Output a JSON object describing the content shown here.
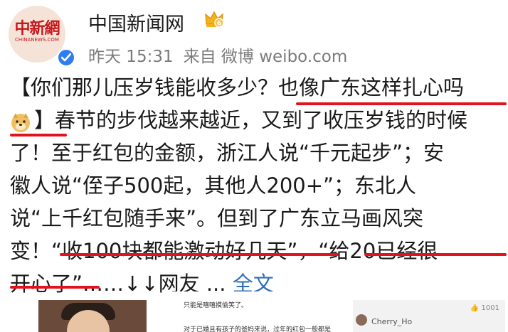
{
  "account": {
    "name": "中国新闻网",
    "avatar_logo": "中新網",
    "avatar_sub": "CHINANEWS.COM",
    "verified_icon": "verified-check-icon",
    "vip_icon": "crown-badge-icon",
    "time": "昨天 15:31",
    "source": "来自 微博 weibo.com"
  },
  "post": {
    "line1": "【你们那儿压岁钱能收多少？也像广东这样扎心吗",
    "line2": "】春节的步伐越来越近，又到了收压岁钱的时候",
    "line3": "了！至于红包的金额，浙江人说“千元起步”；安",
    "line4": "徽人说“侄子500起，其他人200+”；东北人",
    "line5": "说“上千红包随手来”。但到了广东立马画风突",
    "line6": "变！“收100块都能激动好几天”，“给20已经很",
    "line7_text": "开心了”……↓↓网友 ... ",
    "line7_link": "全文",
    "emoji": "doge-emoji",
    "highlight_color": "#e0141e",
    "link_color": "#2f6fb9"
  },
  "previews": {
    "article_line1": "只能是嘻嘻摸偷笑了。",
    "article_line2": "对于已婚且有孩子的爸妈来说，过年的红包一般都是",
    "comment_user": "Cherry_Ho",
    "comment_likes": "1001"
  }
}
